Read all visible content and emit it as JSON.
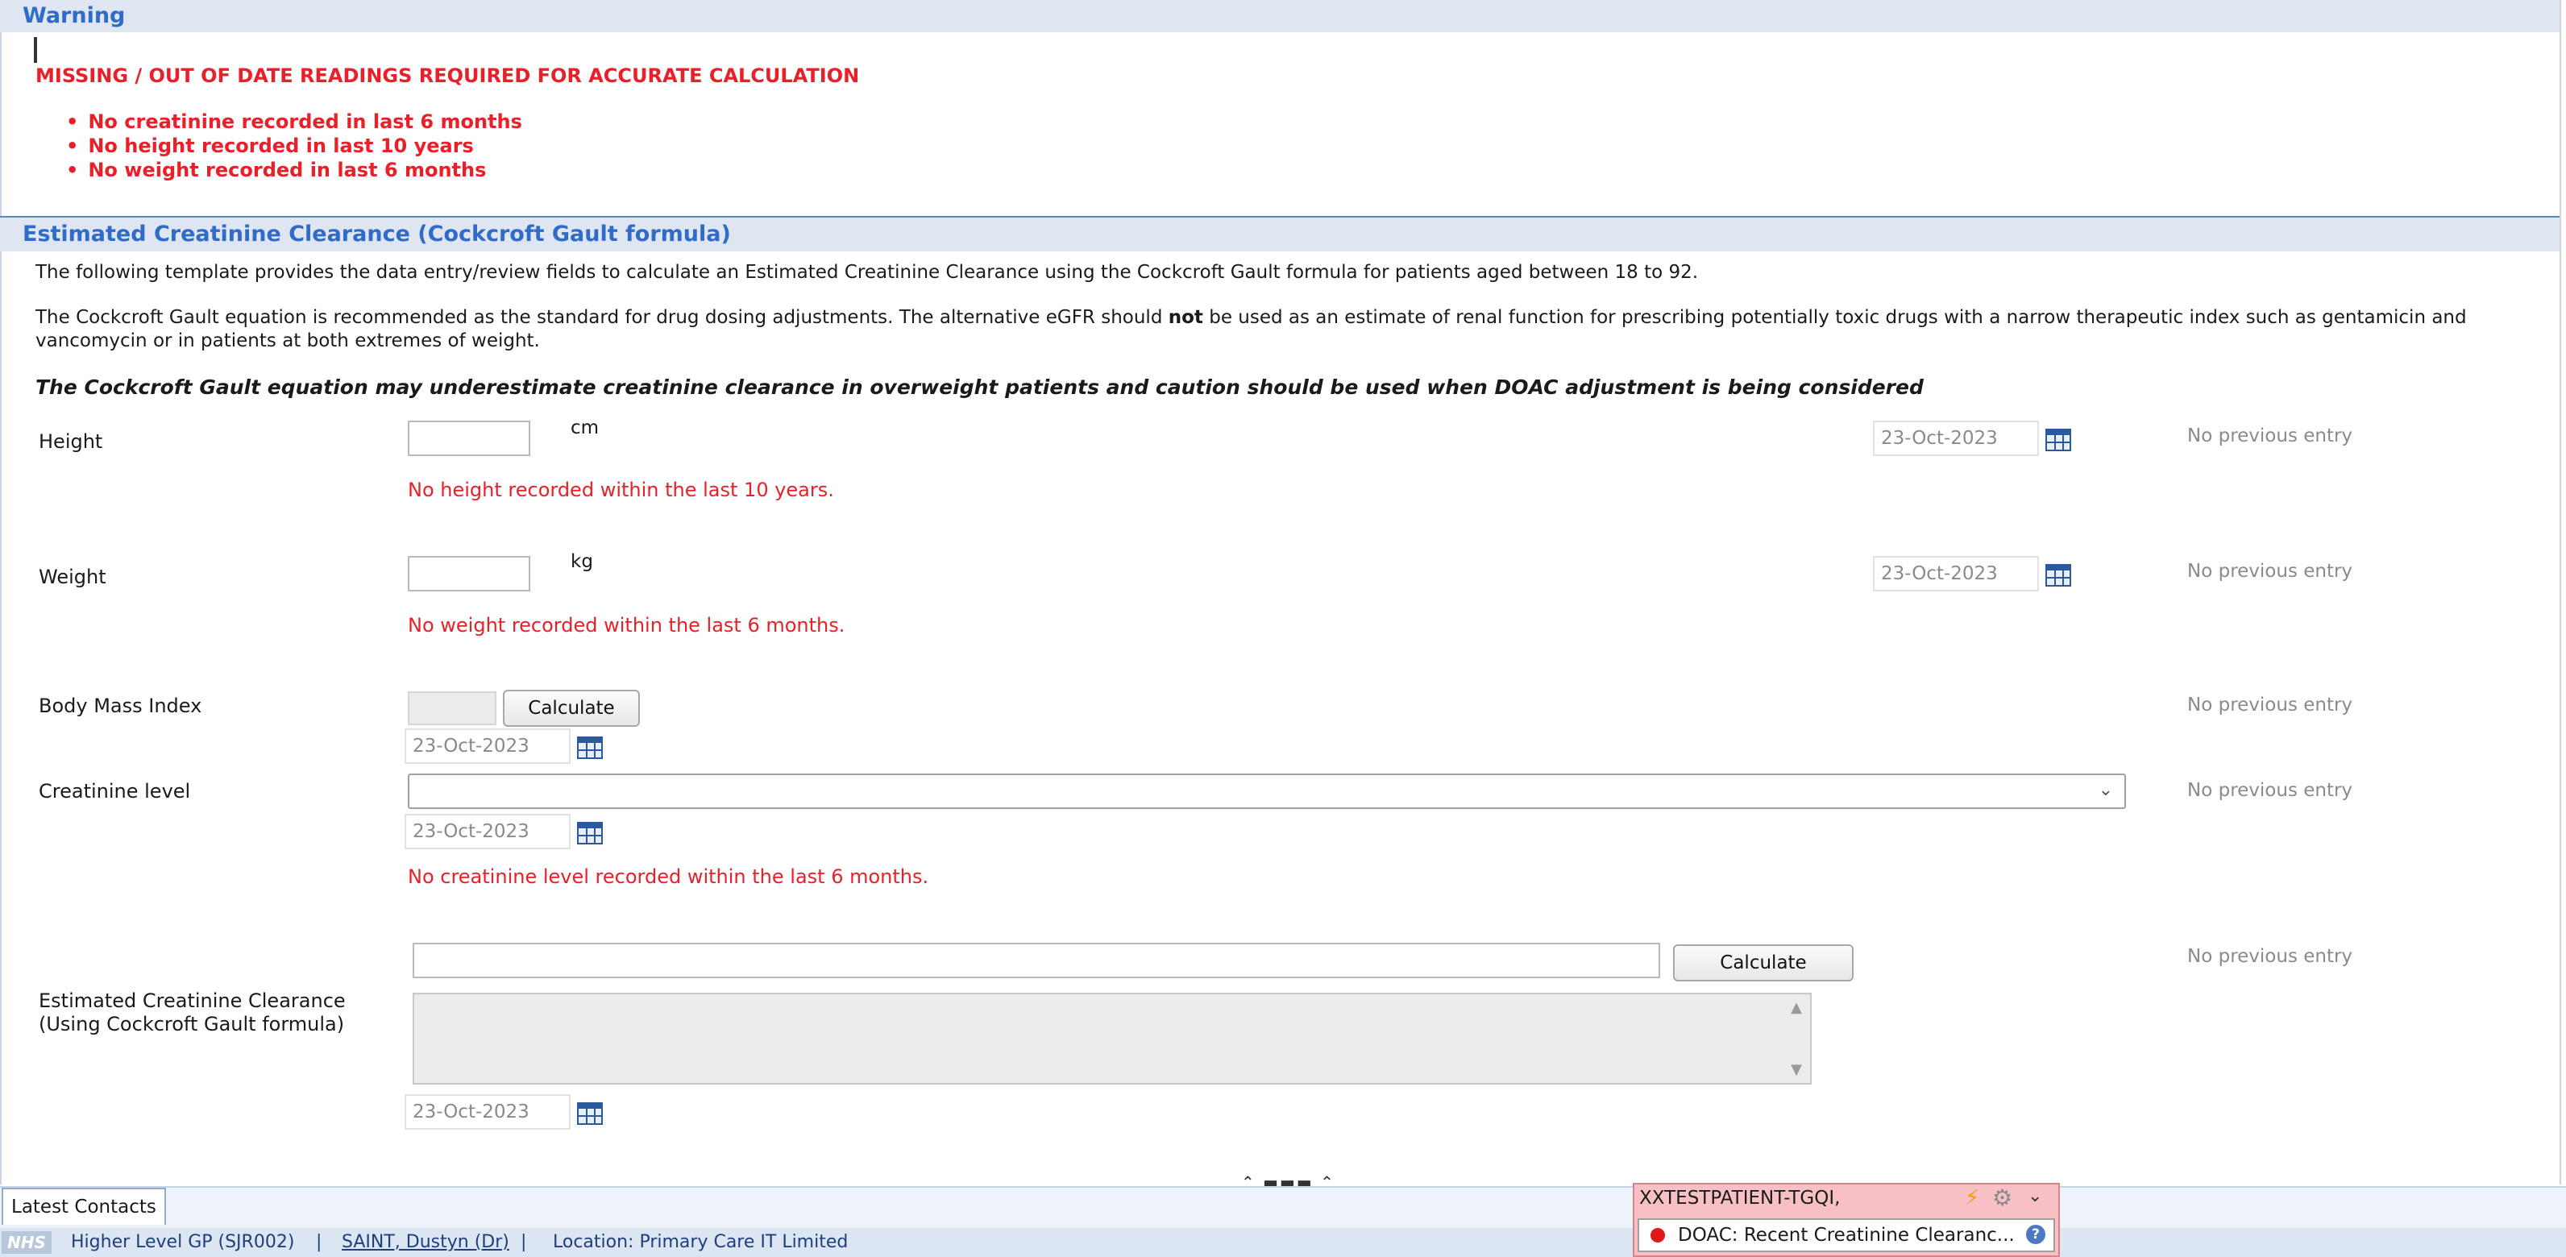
{
  "warning": {
    "header": "Warning",
    "title": "MISSING / OUT OF DATE READINGS REQUIRED FOR ACCURATE CALCULATION",
    "items": [
      "No creatinine recorded in last 6 months",
      "No height recorded in last 10 years",
      "No weight recorded in last 6 months"
    ]
  },
  "ecc": {
    "header": "Estimated Creatinine Clearance (Cockcroft Gault formula)",
    "intro": "The following template provides the data entry/review fields to calculate an Estimated Creatinine Clearance using the Cockcroft Gault formula for patients aged between 18 to 92.",
    "para2_before": "The Cockcroft Gault equation is recommended as the standard for drug dosing adjustments. The alternative eGFR should ",
    "para2_bold": "not",
    "para2_after": " be used as an estimate of renal function for prescribing potentially toxic drugs with a narrow therapeutic index such as gentamicin and vancomycin or in patients at both extremes of weight.",
    "caution": "The Cockcroft Gault equation may underestimate creatinine clearance in overweight patients and caution should be used when DOAC adjustment is being considered"
  },
  "fields": {
    "height": {
      "label": "Height",
      "unit": "cm",
      "value": "",
      "date": "23-Oct-2023",
      "error": "No height recorded within the last 10 years.",
      "previous": "No previous entry"
    },
    "weight": {
      "label": "Weight",
      "unit": "kg",
      "value": "",
      "date": "23-Oct-2023",
      "error": "No weight recorded within the last 6 months.",
      "previous": "No previous entry"
    },
    "bmi": {
      "label": "Body Mass Index",
      "button": "Calculate",
      "date": "23-Oct-2023",
      "previous": "No previous entry"
    },
    "creatinine": {
      "label": "Creatinine level",
      "selected": "",
      "date": "23-Oct-2023",
      "error": "No creatinine level recorded within the last 6 months.",
      "previous": "No previous entry"
    },
    "ecc_result": {
      "label_line1": "Estimated Creatinine Clearance",
      "label_line2": "(Using Cockcroft Gault formula)",
      "button": "Calculate",
      "date": "23-Oct-2023",
      "previous": "No previous entry"
    }
  },
  "bottom": {
    "tab_label": "Latest Contacts",
    "nhs_logo": "NHS",
    "role": "Higher Level  GP (SJR002)",
    "sep1": "|",
    "user": "SAINT, Dustyn (Dr)",
    "sep2": "|",
    "location": "Location:  Primary Care IT Limited"
  },
  "popup": {
    "patient": "XXTESTPATIENT-TGQI,",
    "alert": "DOAC: Recent Creatinine Clearanc...",
    "help": "?"
  },
  "colors": {
    "accent_blue": "#2f6bc7",
    "error_red": "#e8202a",
    "popup_pink": "#f8c0c5"
  }
}
